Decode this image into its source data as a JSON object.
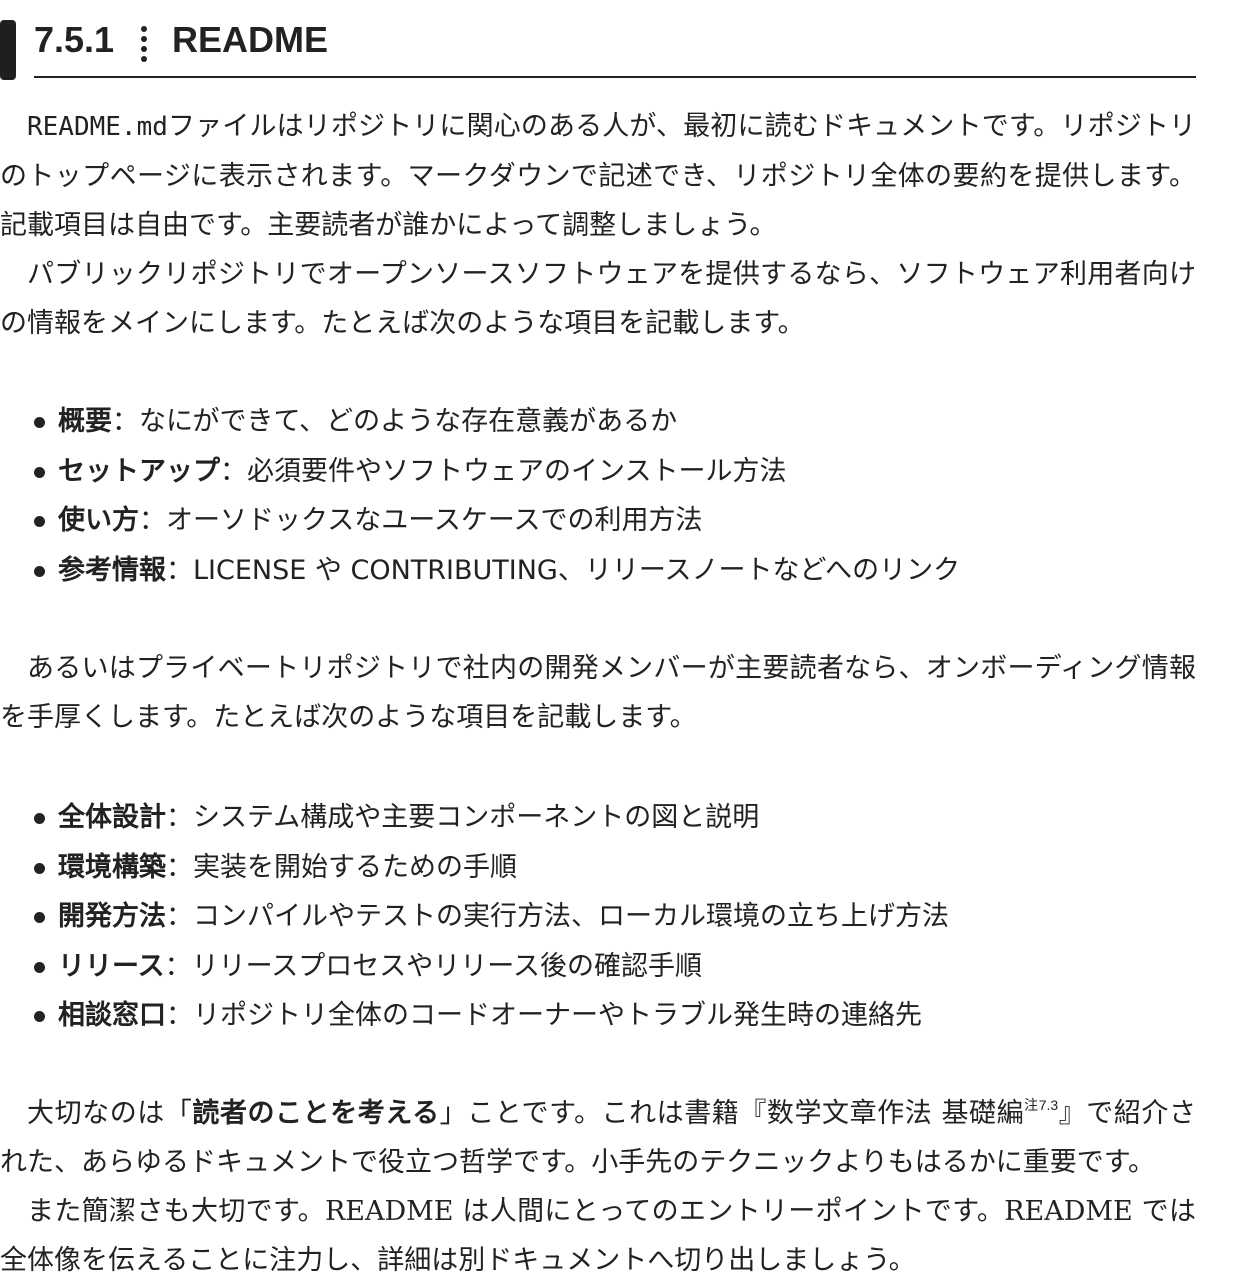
{
  "heading": {
    "number": "7.5.1",
    "title": "README"
  },
  "intro": {
    "p1_code": "README.md",
    "p1_rest": "ファイルはリポジトリに関心のある人が、最初に読むドキュメントです。リポジトリのトップページに表示されます。マークダウンで記述でき、リポジトリ全体の要約を提供します。記載項目は自由です。主要読者が誰かによって調整しましょう。",
    "p2": "パブリックリポジトリでオープンソースソフトウェアを提供するなら、ソフトウェア利用者向けの情報をメインにします。たとえば次のような項目を記載します。"
  },
  "public_list": [
    {
      "term": "概要",
      "desc": "：なにができて、どのような存在意義があるか"
    },
    {
      "term": "セットアップ",
      "desc": "：必須要件やソフトウェアのインストール方法"
    },
    {
      "term": "使い方",
      "desc": "：オーソドックスなユースケースでの利用方法"
    },
    {
      "term": "参考情報",
      "desc": "：LICENSE や CONTRIBUTING、リリースノートなどへのリンク"
    }
  ],
  "private_intro": "あるいはプライベートリポジトリで社内の開発メンバーが主要読者なら、オンボーディング情報を手厚くします。たとえば次のような項目を記載します。",
  "private_list": [
    {
      "term": "全体設計",
      "desc": "：システム構成や主要コンポーネントの図と説明"
    },
    {
      "term": "環境構築",
      "desc": "：実装を開始するための手順"
    },
    {
      "term": "開発方法",
      "desc": "：コンパイルやテストの実行方法、ローカル環境の立ち上げ方法"
    },
    {
      "term": "リリース",
      "desc": "：リリースプロセスやリリース後の確認手順"
    },
    {
      "term": "相談窓口",
      "desc": "：リポジトリ全体のコードオーナーやトラブル発生時の連絡先"
    }
  ],
  "closing": {
    "p1_before": "大切なのは「",
    "p1_emph": "読者のことを考える",
    "p1_mid": "」ことです。これは書籍『数学文章作法 基礎編",
    "p1_note": "注7.3",
    "p1_after": "』で紹介された、あらゆるドキュメントで役立つ哲学です。小手先のテクニックよりもはるかに重要です。",
    "p2": "また簡潔さも大切です。README は人間にとってのエントリーポイントです。README では全体像を伝えることに注力し、詳細は別ドキュメントへ切り出しましょう。"
  }
}
